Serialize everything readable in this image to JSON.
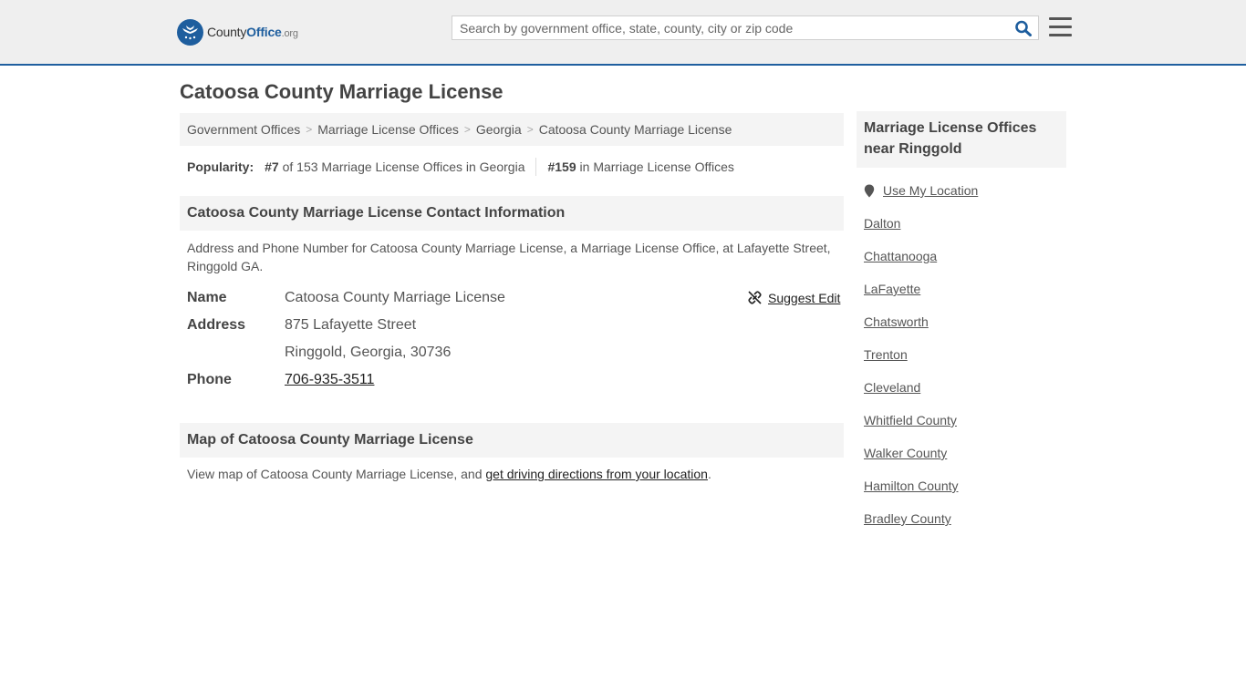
{
  "header": {
    "logo": {
      "part1": "County",
      "part2": "Office",
      "part3": ".org"
    },
    "search": {
      "placeholder": "Search by government office, state, county, city or zip code"
    }
  },
  "page": {
    "title": "Catoosa County Marriage License"
  },
  "breadcrumb": [
    "Government Offices",
    "Marriage License Offices",
    "Georgia",
    "Catoosa County Marriage License"
  ],
  "popularity": {
    "label": "Popularity:",
    "state_rank": "#7",
    "state_text": "of 153 Marriage License Offices in Georgia",
    "national_rank": "#159",
    "national_text": "in Marriage License Offices"
  },
  "contact": {
    "heading": "Catoosa County Marriage License Contact Information",
    "description": "Address and Phone Number for Catoosa County Marriage License, a Marriage License Office, at Lafayette Street, Ringgold GA.",
    "suggest_edit": "Suggest Edit",
    "name_label": "Name",
    "name_value": "Catoosa County Marriage License",
    "address_label": "Address",
    "address_line1": "875 Lafayette Street",
    "address_line2": "Ringgold, Georgia, 30736",
    "phone_label": "Phone",
    "phone_value": "706-935-3511"
  },
  "map": {
    "heading": "Map of Catoosa County Marriage License",
    "text_before": "View map of Catoosa County Marriage License, and ",
    "link_text": "get driving directions from your location",
    "text_after": "."
  },
  "sidebar": {
    "heading": "Marriage License Offices near Ringgold",
    "use_location": "Use My Location",
    "links": [
      "Dalton",
      "Chattanooga",
      "LaFayette",
      "Chatsworth",
      "Trenton",
      "Cleveland",
      "Whitfield County",
      "Walker County",
      "Hamilton County",
      "Bradley County"
    ]
  },
  "colors": {
    "brand": "#1e5e9e",
    "header_bg": "#efefef",
    "panel_bg": "#f4f4f4",
    "text": "#555555"
  },
  "icons": {
    "search": "search-icon",
    "menu": "hamburger-menu-icon",
    "location": "map-pin-icon",
    "edit": "broken-link-edit-icon"
  }
}
